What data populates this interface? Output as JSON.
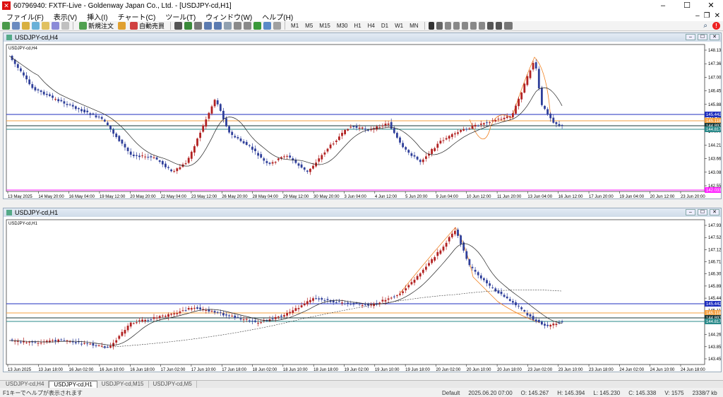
{
  "window": {
    "title": "60796940: FXTF-Live - Goldenway Japan Co., Ltd. - [USDJPY-cd,H1]"
  },
  "menu": [
    "ファイル(F)",
    "表示(V)",
    "挿入(I)",
    "チャート(C)",
    "ツール(T)",
    "ウィンドウ(W)",
    "ヘルプ(H)"
  ],
  "toolbar": {
    "new_order_label": "新規注文",
    "auto_trade_label": "自動売買",
    "timeframes": [
      "M1",
      "M5",
      "M15",
      "M30",
      "H1",
      "H4",
      "D1",
      "W1",
      "MN"
    ]
  },
  "colors": {
    "bull": "#b22222",
    "bear": "#2f3f9a",
    "blue_line": "#1f2fbf",
    "orange_line": "#f5a040",
    "teal_line": "#2a8a8a",
    "magenta_line": "#ff22ff",
    "ma": "#222222",
    "fib": "#f08020"
  },
  "charts": [
    {
      "title": "USDJPY-cd,H4",
      "label": "USDJPY-cd,H4",
      "price_ticks": [
        "148.130",
        "147.360",
        "147.005",
        "146.455",
        "145.885",
        "145.350",
        "144.770",
        "144.215",
        "143.660",
        "143.085",
        "142.550"
      ],
      "line_labels": {
        "blue": "145.442",
        "orange": "145.118",
        "dark": "144.897",
        "teal": "144.817",
        "magenta": "142.033"
      },
      "time_labels": [
        "13 May 2025",
        "14 May 20:00",
        "16 May 04:00",
        "19 May 12:00",
        "20 May 20:00",
        "22 May 04:00",
        "23 May 12:00",
        "26 May 20:00",
        "28 May 04:00",
        "29 May 12:00",
        "30 May 20:00",
        "3 Jun 04:00",
        "4 Jun 12:00",
        "5 Jun 20:00",
        "9 Jun 04:00",
        "10 Jun 12:00",
        "11 Jun 20:00",
        "13 Jun 04:00",
        "16 Jun 12:00",
        "17 Jun 20:00",
        "19 Jun 04:00",
        "20 Jun 12:00",
        "23 Jun 20:00"
      ]
    },
    {
      "title": "USDJPY-cd,H1",
      "label": "USDJPY-cd,H1",
      "price_ticks": [
        "147.930",
        "147.520",
        "147.120",
        "146.710",
        "146.300",
        "145.890",
        "145.442",
        "145.110",
        "144.670",
        "144.260",
        "143.850",
        "143.450"
      ],
      "line_labels": {
        "blue": "145.442",
        "orange": "145.118",
        "dark": "144.897",
        "teal": "144.817"
      },
      "time_labels": [
        "13 Jun 2025",
        "13 Jun 18:00",
        "16 Jun 02:00",
        "16 Jun 10:00",
        "16 Jun 18:00",
        "17 Jun 02:00",
        "17 Jun 10:00",
        "17 Jun 18:00",
        "18 Jun 02:00",
        "18 Jun 10:00",
        "18 Jun 18:00",
        "19 Jun 02:00",
        "19 Jun 10:00",
        "19 Jun 18:00",
        "20 Jun 02:00",
        "20 Jun 10:00",
        "20 Jun 18:00",
        "23 Jun 02:00",
        "23 Jun 10:00",
        "23 Jun 18:00",
        "24 Jun 02:00",
        "24 Jun 10:00",
        "24 Jun 18:00"
      ]
    }
  ],
  "tabs": [
    "USDJPY-cd,H4",
    "USDJPY-cd,H1",
    "USDJPY-cd,M15",
    "USDJPY-cd,M5"
  ],
  "active_tab": 1,
  "status": {
    "help": "F1キーでヘルプが表示されます",
    "profile": "Default",
    "time": "2025.06.20 07:00",
    "open": "O: 145.267",
    "high": "H: 145.394",
    "low": "L: 145.230",
    "close": "C: 145.338",
    "volume": "V: 1575",
    "traffic": "2338/7 kb"
  }
}
